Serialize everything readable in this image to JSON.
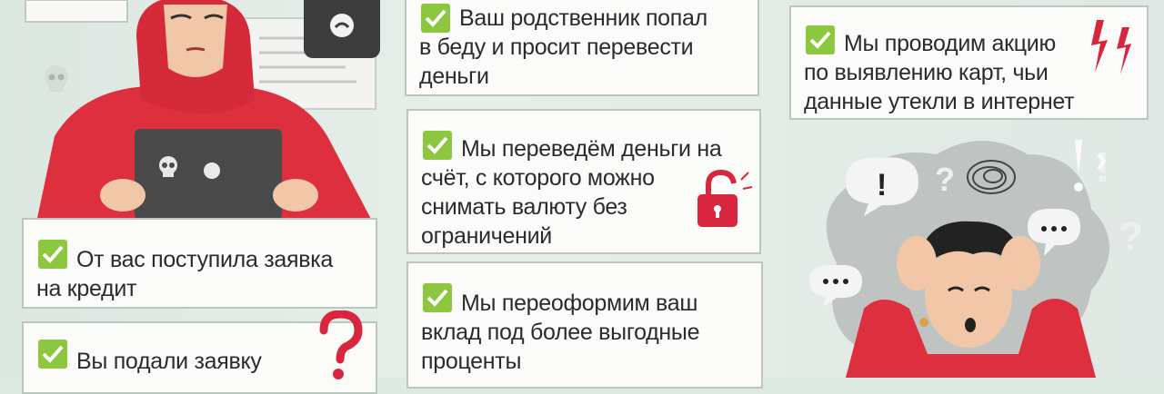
{
  "cards": {
    "relative": {
      "lines": [
        "Ваш родственник попал",
        "в беду и просит перевести",
        "деньги"
      ]
    },
    "promo": {
      "lines": [
        "Мы проводим акцию",
        "по выявлению карт, чьи",
        "данные утекли в интернет"
      ]
    },
    "transfer": {
      "lines": [
        "Мы переведём деньги на",
        "счёт, с которого можно",
        "снимать валюту без",
        "ограничений"
      ]
    },
    "credit": {
      "lines": [
        "От вас поступила заявка",
        "на кредит"
      ]
    },
    "deposit": {
      "lines": [
        "Мы переоформим ваш",
        "вклад под более выгодные",
        "проценты"
      ]
    },
    "application": {
      "lines": [
        "Вы подали заявку"
      ]
    }
  },
  "icons": {
    "check": "check-icon",
    "lock": "open-padlock-icon",
    "question": "question-mark-icon",
    "skull": "skull-icon",
    "lightning": "lightning-icon",
    "phone": "phone-icon"
  },
  "colors": {
    "accent_red": "#d7263d",
    "check_green": "#8dc63f",
    "card_bg": "#fbfbfa",
    "background": "#dfe9e3"
  }
}
